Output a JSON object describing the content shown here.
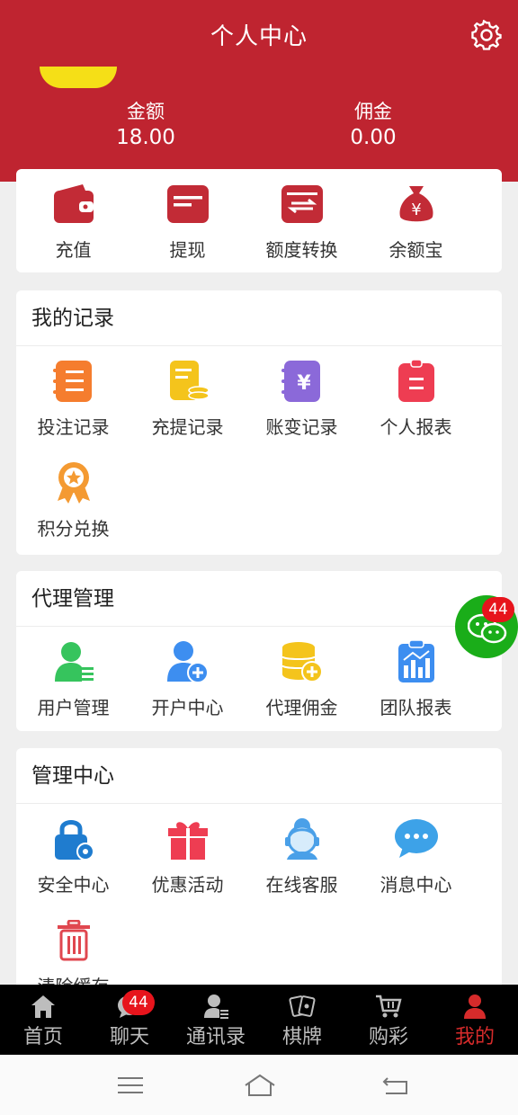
{
  "header": {
    "title": "个人中心",
    "amount_label": "金额",
    "amount_value": "18.00",
    "commission_label": "佣金",
    "commission_value": "0.00",
    "settings_icon": "gear-icon"
  },
  "quick_actions": [
    {
      "label": "充值",
      "icon": "wallet-icon"
    },
    {
      "label": "提现",
      "icon": "card-icon"
    },
    {
      "label": "额度转换",
      "icon": "transfer-icon"
    },
    {
      "label": "余额宝",
      "icon": "money-bag-icon"
    }
  ],
  "records": {
    "title": "我的记录",
    "items": [
      {
        "label": "投注记录",
        "icon": "bet-list-icon"
      },
      {
        "label": "充提记录",
        "icon": "deposit-list-icon"
      },
      {
        "label": "账变记录",
        "icon": "yen-book-icon"
      },
      {
        "label": "个人报表",
        "icon": "clipboard-icon"
      },
      {
        "label": "积分兑换",
        "icon": "medal-icon"
      }
    ]
  },
  "agent": {
    "title": "代理管理",
    "items": [
      {
        "label": "用户管理",
        "icon": "user-list-icon"
      },
      {
        "label": "开户中心",
        "icon": "user-add-icon"
      },
      {
        "label": "代理佣金",
        "icon": "coins-icon"
      },
      {
        "label": "团队报表",
        "icon": "report-chart-icon"
      }
    ]
  },
  "management": {
    "title": "管理中心",
    "items": [
      {
        "label": "安全中心",
        "icon": "lock-gear-icon"
      },
      {
        "label": "优惠活动",
        "icon": "gift-icon"
      },
      {
        "label": "在线客服",
        "icon": "headset-agent-icon"
      },
      {
        "label": "消息中心",
        "icon": "chat-bubble-icon"
      },
      {
        "label": "清除缓存",
        "icon": "trash-icon"
      }
    ]
  },
  "floating_chat": {
    "badge": "44",
    "icon": "wechat-icon"
  },
  "tabbar": {
    "tabs": [
      {
        "label": "首页",
        "icon": "home-icon"
      },
      {
        "label": "聊天",
        "icon": "chat-icon",
        "badge": "44"
      },
      {
        "label": "通讯录",
        "icon": "contacts-icon"
      },
      {
        "label": "棋牌",
        "icon": "cards-icon"
      },
      {
        "label": "购彩",
        "icon": "cart-icon"
      },
      {
        "label": "我的",
        "icon": "person-icon"
      }
    ],
    "active": "我的"
  },
  "colors": {
    "brand": "#bf2430",
    "active_tab": "#d62b2b",
    "chat_green": "#1aad19",
    "badge": "#e7141c"
  }
}
